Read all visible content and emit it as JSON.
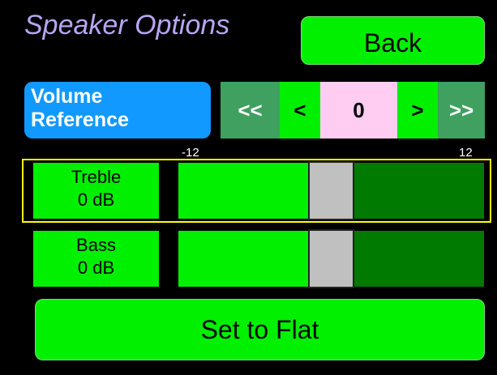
{
  "title": "Speaker Options",
  "back_label": "Back",
  "volume": {
    "label_line1": "Volume",
    "label_line2": "Reference",
    "btn_big_down": "<<",
    "btn_down": "<",
    "value": "0",
    "btn_up": ">",
    "btn_big_up": ">>"
  },
  "scale": {
    "min_label": "-12",
    "max_label": "12",
    "min": -12,
    "max": 12
  },
  "treble": {
    "name": "Treble",
    "value_text": "0 dB",
    "value": 0,
    "selected": true
  },
  "bass": {
    "name": "Bass",
    "value_text": "0 dB",
    "value": 0,
    "selected": false
  },
  "flat_label": "Set to Flat",
  "colors": {
    "background": "#000000",
    "bright_green": "#00f000",
    "dark_green": "#007a00",
    "step_green": "#40a060",
    "blue": "#1199ff",
    "pink": "#ffccf2",
    "lavender": "#b8a6f0",
    "selection": "#ffff00",
    "thumb": "#c0c0c0"
  }
}
